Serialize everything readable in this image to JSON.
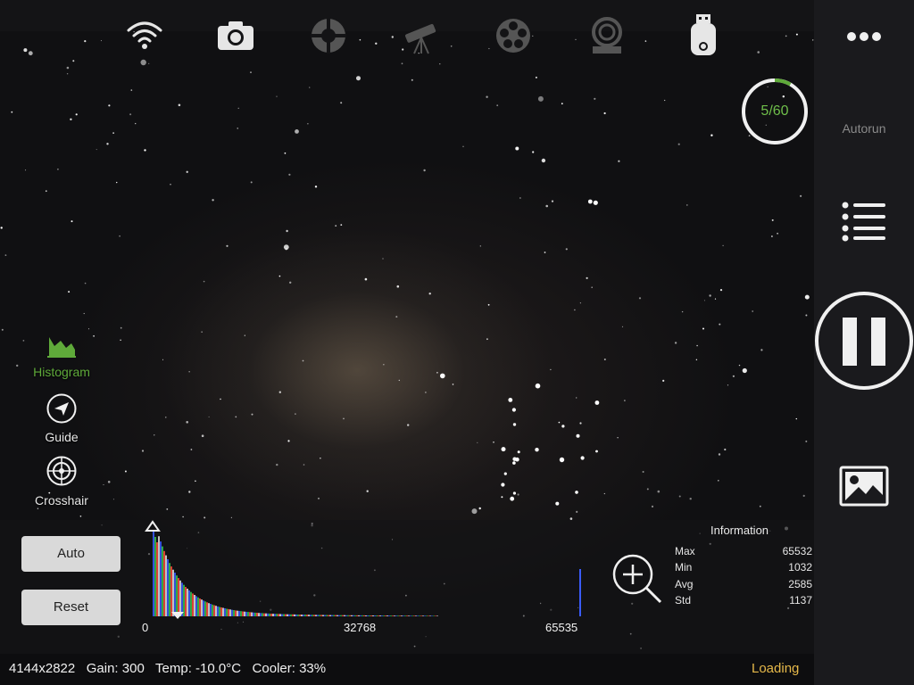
{
  "toolbar": {
    "icons": [
      "wifi-icon",
      "camera-icon",
      "focuser-icon",
      "telescope-icon",
      "filter-wheel-icon",
      "rotator-icon",
      "usb-drive-icon"
    ]
  },
  "sidebar": {
    "more_icon": "more-icon",
    "counter": {
      "text": "5/60",
      "progress": 0.083
    },
    "autorun_label": "Autorun",
    "list_icon": "list-icon",
    "pause_icon": "pause-icon",
    "gallery_icon": "image-gallery-icon"
  },
  "tools": [
    {
      "label": "Histogram",
      "icon": "histogram-icon",
      "active": true
    },
    {
      "label": "Guide",
      "icon": "guide-icon",
      "active": false
    },
    {
      "label": "Crosshair",
      "icon": "crosshair-icon",
      "active": false
    }
  ],
  "histogram": {
    "auto_label": "Auto",
    "reset_label": "Reset",
    "axis_min": "0",
    "axis_mid": "32768",
    "axis_max": "65535",
    "black_point": 0.04,
    "white_point": 0.0
  },
  "info": {
    "title": "Information",
    "rows": [
      {
        "key": "Max",
        "value": "65532"
      },
      {
        "key": "Min",
        "value": "1032"
      },
      {
        "key": "Avg",
        "value": "2585"
      },
      {
        "key": "Std",
        "value": "1137"
      }
    ]
  },
  "status": {
    "text": "4144x2822   Gain: 300   Temp: -10.0°C   Cooler: 33%",
    "state": "Loading"
  },
  "colors": {
    "accent_green": "#5faa3a",
    "loading": "#e6b94a"
  }
}
